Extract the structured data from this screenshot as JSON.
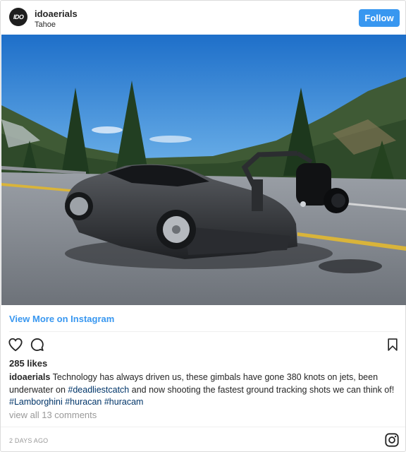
{
  "post": {
    "username": "idoaerials",
    "location": "Tahoe",
    "avatar_text": "IDO",
    "follow_label": "Follow",
    "view_more_label": "View More on Instagram",
    "likes": "285 likes",
    "caption": {
      "username": "idoaerials",
      "text_1": " Technology has always driven us, these gimbals have gone 380 knots on jets, been underwater on ",
      "tag_1": "#deadliestcatch",
      "text_2": " and now shooting the fastest ground tracking shots we can think of! ",
      "tag_2": "#Lamborghini",
      "tag_3": "#huracan",
      "tag_4": "#huracam"
    },
    "comments_label": "view all 13 comments",
    "timestamp": "2 DAYS AGO"
  },
  "icons": {
    "like": "heart-icon",
    "comment": "comment-icon",
    "save": "bookmark-icon",
    "instagram": "instagram-logo-icon"
  },
  "colors": {
    "follow_button": "#3897f0",
    "link": "#3897f0",
    "hashtag": "#003569",
    "muted": "#999999",
    "text": "#262626"
  }
}
